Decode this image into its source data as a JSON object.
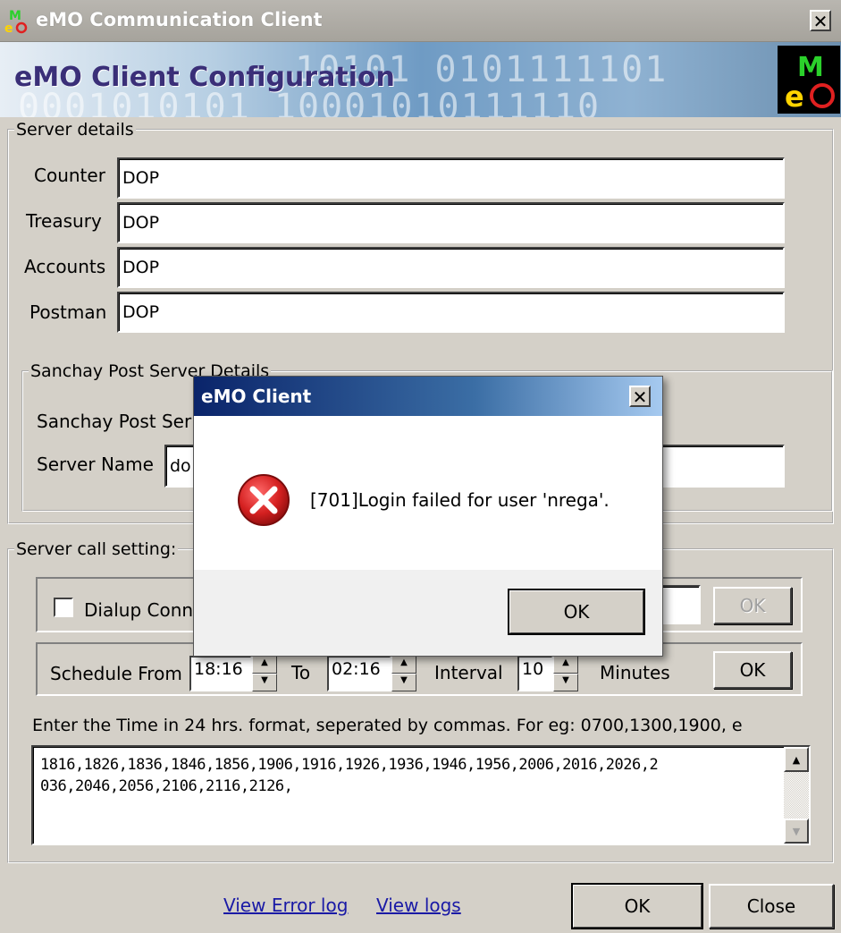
{
  "window": {
    "title": "eMO Communication Client",
    "close_label": "✕"
  },
  "banner": {
    "heading": "eMO Client Configuration",
    "digits_top": "10101   0101111101",
    "digits_bottom": "0001010101  10001010111110"
  },
  "server_details": {
    "legend": "Server details",
    "fields": [
      {
        "label": "Counter",
        "value": "DOP"
      },
      {
        "label": "Treasury",
        "value": "DOP"
      },
      {
        "label": "Accounts",
        "value": "DOP"
      },
      {
        "label": "Postman",
        "value": "DOP"
      }
    ]
  },
  "sanchay": {
    "legend": "Sanchay Post Server Details",
    "post_server_label": "Sanchay Post Ser",
    "server_name_label": "Server Name",
    "server_name_value": "do"
  },
  "server_call": {
    "legend": "Server call setting:",
    "dialup_label": "Dialup Conn",
    "dialup_ok": "OK",
    "schedule_from_label": "Schedule From",
    "from_value": "18:16",
    "to_label": "To",
    "to_value": "02:16",
    "interval_label": "Interval",
    "interval_value": "10",
    "minutes_label": "Minutes",
    "schedule_ok": "OK",
    "hint": "Enter the Time in 24 hrs. format, seperated by commas.  For eg: 0700,1300,1900, e",
    "times_line1": "1816,1826,1836,1846,1856,1906,1916,1926,1936,1946,1956,2006,2016,2026,2",
    "times_line2": "036,2046,2056,2106,2116,2126,"
  },
  "footer": {
    "view_error_log": "View Error log",
    "view_logs": "View logs",
    "ok": "OK",
    "close": "Close"
  },
  "dialog": {
    "title": "eMO Client",
    "message": "[701]Login failed for user 'nrega'.",
    "ok": "OK",
    "close_label": "✕"
  },
  "colors": {
    "dialog_title_start": "#0a246a",
    "error_red": "#d42020"
  }
}
